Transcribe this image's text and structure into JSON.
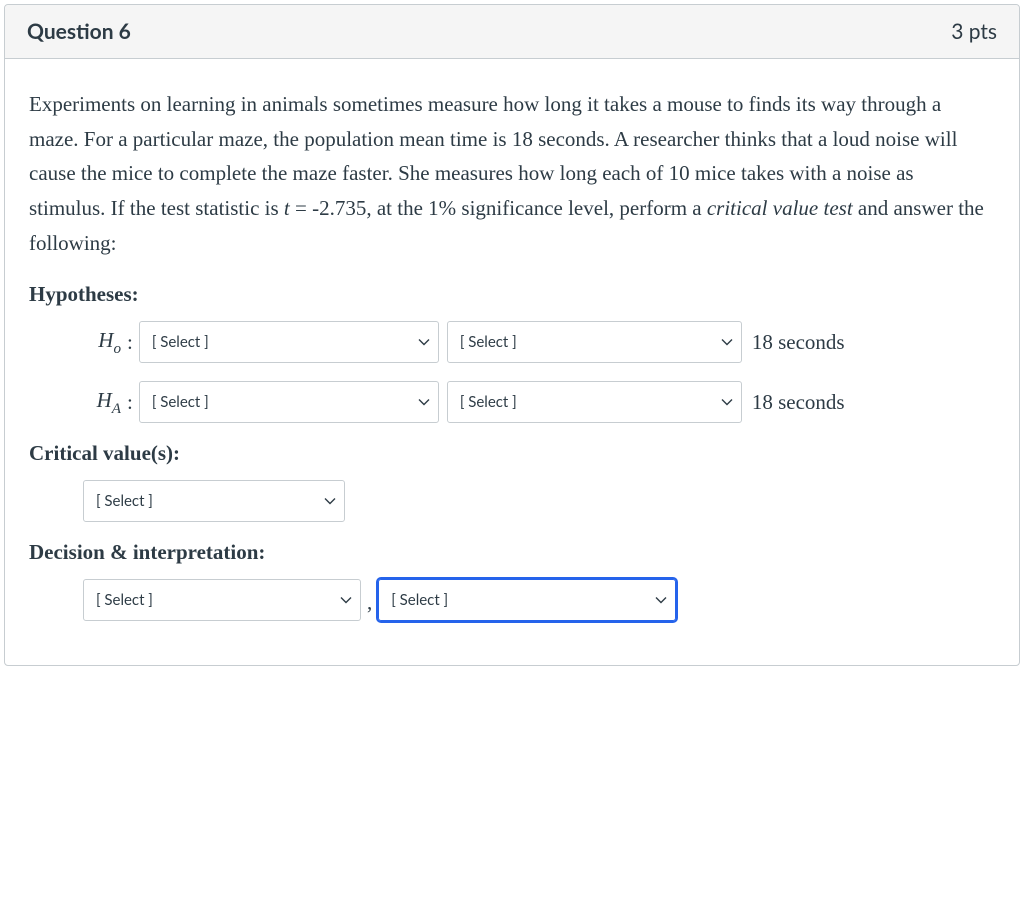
{
  "header": {
    "title": "Question 6",
    "points": "3 pts"
  },
  "prompt": {
    "text_before_t": "Experiments on learning in animals sometimes measure how long it takes a mouse to finds its way through a maze. For a particular maze, the population mean time is 18 seconds. A researcher thinks that a loud noise will cause the mice to complete the maze faster. She measures how long each of 10 mice takes with a noise as stimulus. If the test statistic is ",
    "t_var": "t",
    "t_val": " = -2.735, at the 1% significance level, perform a ",
    "cv_em": "critical value test",
    "text_after": " and answer the following:"
  },
  "sections": {
    "hypotheses": "Hypotheses:",
    "critical": "Critical value(s):",
    "decision": "Decision & interpretation:"
  },
  "hypotheses": {
    "h0_label_main": "H",
    "h0_label_sub": "o",
    "ha_label_main": "H",
    "ha_label_sub": "A",
    "colon": ":",
    "h0_sel1": "[ Select ]",
    "h0_sel2": "[ Select ]",
    "h0_trail": "18 seconds",
    "ha_sel1": "[ Select ]",
    "ha_sel2": "[ Select ]",
    "ha_trail": "18 seconds"
  },
  "critical": {
    "sel": "[ Select ]"
  },
  "decision": {
    "sel1": "[ Select ]",
    "comma": ",",
    "sel2": "[ Select ]"
  }
}
